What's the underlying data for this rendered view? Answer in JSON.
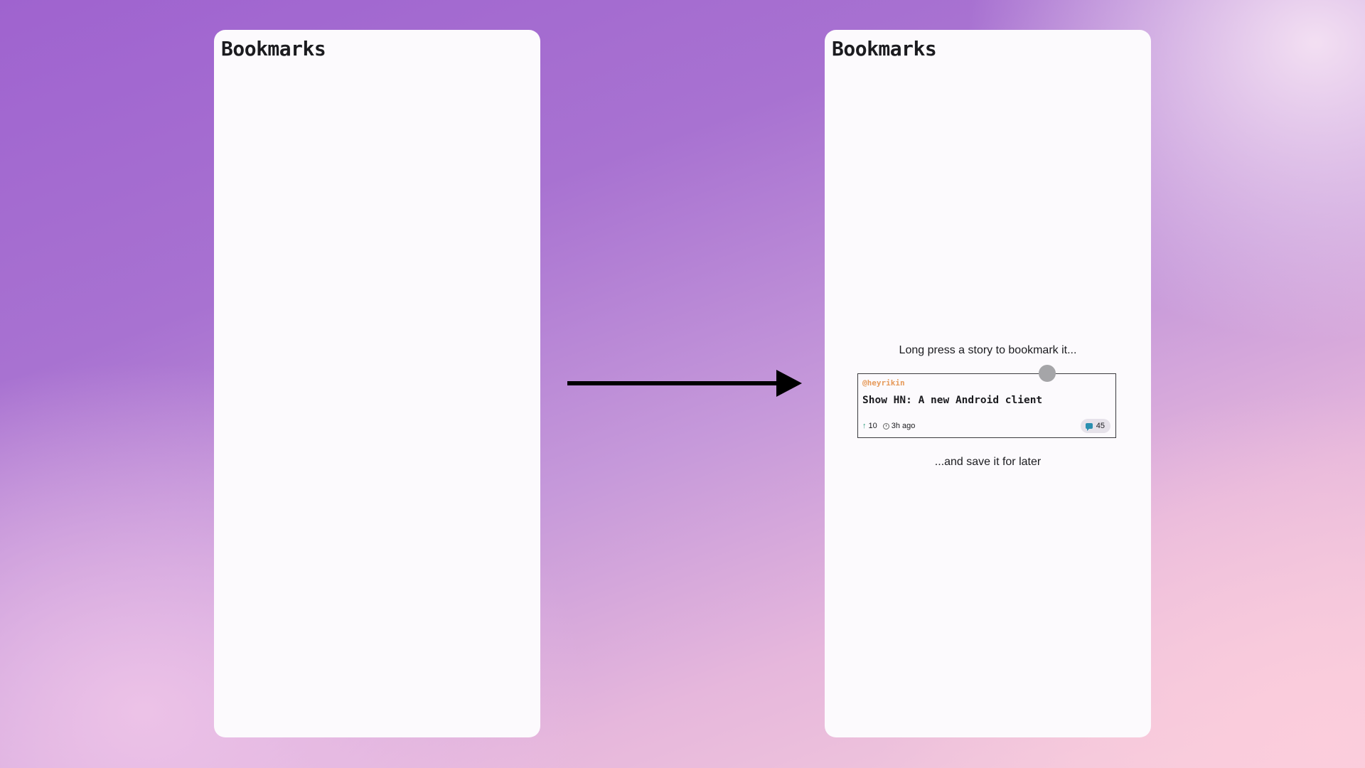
{
  "left_panel": {
    "title": "Bookmarks"
  },
  "right_panel": {
    "title": "Bookmarks",
    "hint_top": "Long press a story to bookmark it...",
    "hint_bottom": "...and save it for later",
    "story": {
      "author": "@heyrikin",
      "title": "Show HN: A new Android client",
      "points": "10",
      "age": "3h ago",
      "comments": "45"
    }
  },
  "icons": {
    "arrow": "arrow-right-icon",
    "upvote": "arrow-up-icon",
    "clock": "clock-icon",
    "comment": "comment-icon",
    "touch": "touch-indicator"
  },
  "colors": {
    "author": "#e69a5a",
    "upvote": "#2a9a7a",
    "comment": "#2a8fb0",
    "panel_bg": "#fcfafd"
  }
}
